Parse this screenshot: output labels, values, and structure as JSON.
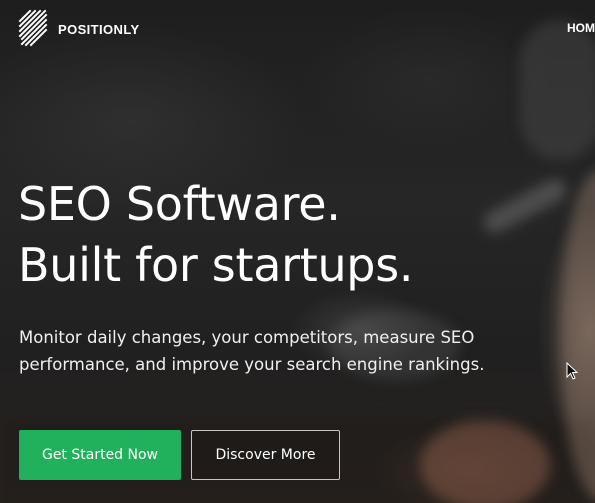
{
  "header": {
    "brand": "POSITIONLY",
    "logo_icon": "positionly-stripes-logo",
    "nav": [
      {
        "label": "HOM"
      }
    ]
  },
  "hero": {
    "headline_line1": "SEO Software.",
    "headline_line2": "Built for startups.",
    "description_line1": "Monitor daily changes, your competitors, measure SEO",
    "description_line2": "performance, and improve your search engine rankings.",
    "primary_cta": "Get Started Now",
    "secondary_cta": "Discover More"
  },
  "colors": {
    "accent_green": "#21b15c",
    "text": "#ffffff",
    "overlay": "#1e1e1e"
  },
  "icons": {
    "cursor": "mouse-pointer-icon"
  }
}
